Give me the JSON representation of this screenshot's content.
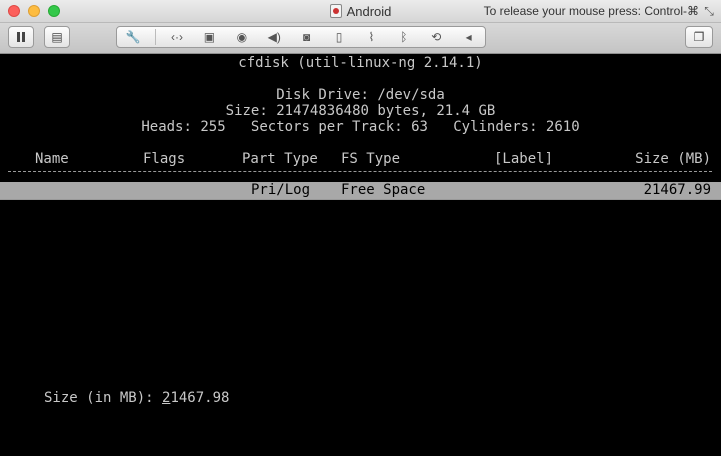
{
  "window": {
    "title": "Android",
    "release_hint": "To release your mouse press: Control-⌘"
  },
  "toolbar": {
    "pause_icon": "pause-icon",
    "capture_icon": "snapshot-icon",
    "devices": [
      "wrench-icon",
      "network-icon",
      "hard-disk-icon",
      "optical-drive-icon",
      "audio-icon",
      "camera-icon",
      "mouse-icon",
      "serial-port-icon",
      "bluetooth-icon",
      "shared-folder-icon",
      "chevron-left-icon"
    ],
    "window_icon": "restore-window-icon"
  },
  "terminal": {
    "program": "cfdisk (util-linux-ng 2.14.1)",
    "disk_drive": "Disk Drive: /dev/sda",
    "size_line": "Size: 21474836480 bytes, 21.4 GB",
    "geometry_line": "Heads: 255   Sectors per Track: 63   Cylinders: 2610",
    "columns": {
      "name": "Name",
      "flags": "Flags",
      "part_type": "Part Type",
      "fs_type": "FS Type",
      "label": "[Label]",
      "size": "Size (MB)"
    },
    "rows": [
      {
        "name": "",
        "flags": "",
        "part_type": "Pri/Log",
        "fs_type": "Free Space",
        "label": "",
        "size": "21467.99"
      }
    ],
    "prompt_label": "Size (in MB): ",
    "prompt_value_first": "2",
    "prompt_value_rest": "1467.98"
  }
}
